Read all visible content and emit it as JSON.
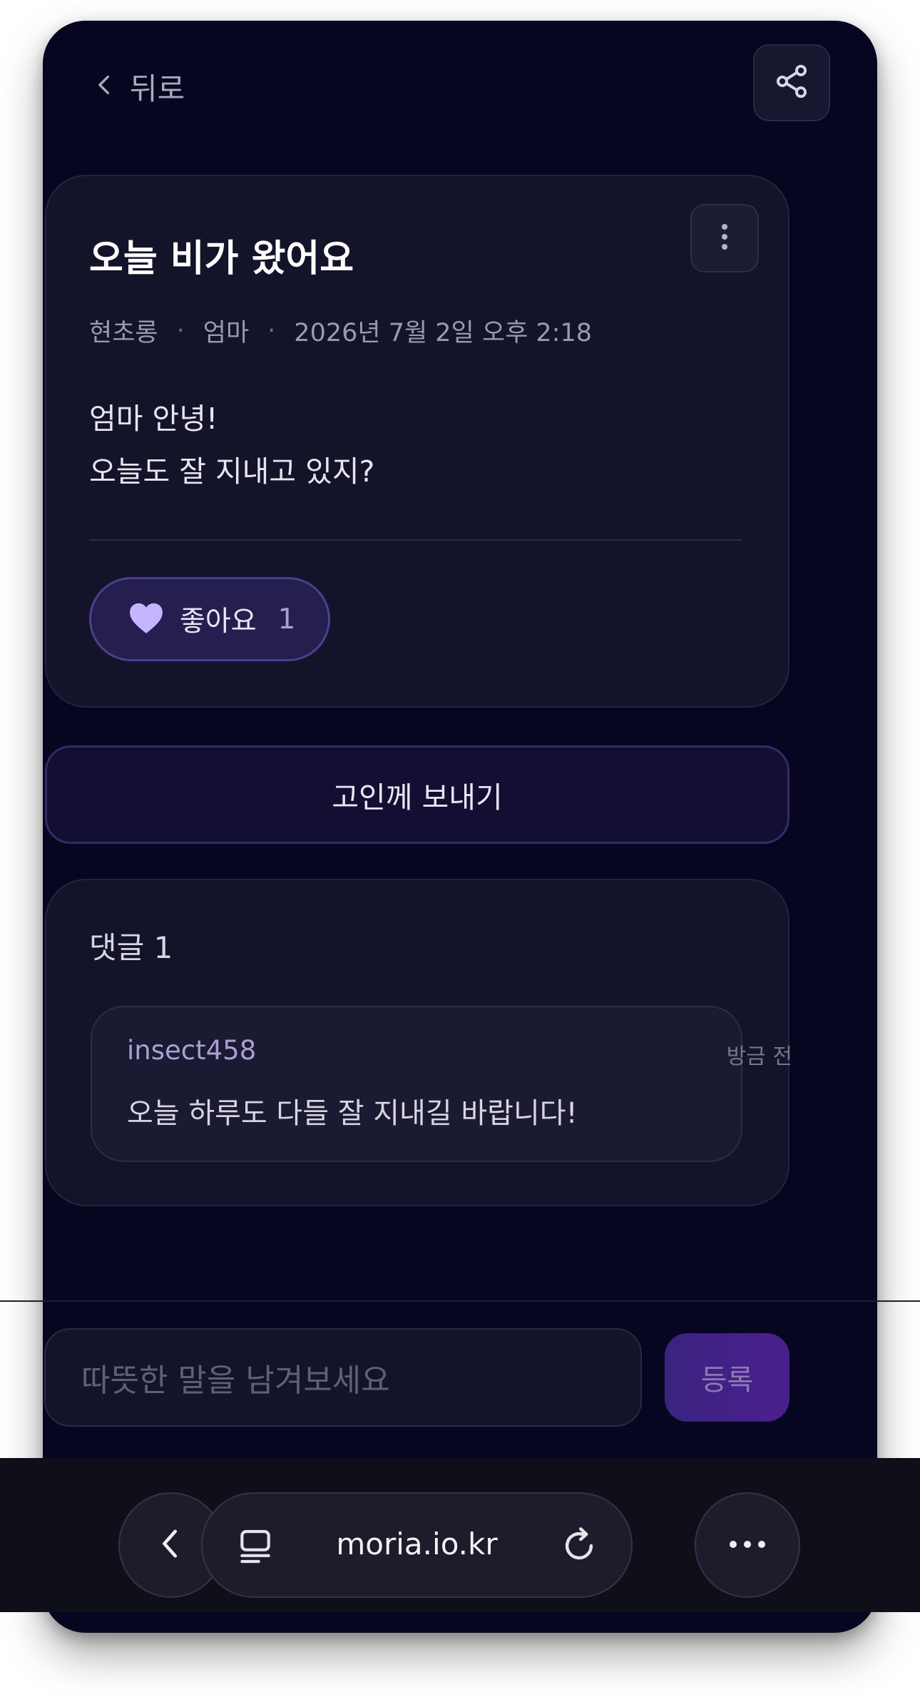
{
  "header": {
    "back_label": "뒤로"
  },
  "post": {
    "title": "오늘 비가 왔어요",
    "author": "현초롱",
    "recipient": "엄마",
    "datetime": "2026년 7월 2일 오후 2:18",
    "body_lines": [
      "엄마 안녕!",
      "오늘도 잘 지내고 있지?"
    ],
    "like_label": "좋아요",
    "like_count": "1"
  },
  "send_button_label": "고인께 보내기",
  "comments": {
    "title": "댓글 1",
    "items": [
      {
        "user": "insect458",
        "time": "방금 전",
        "text": "오늘 하루도 다들 잘 지내길 바랍니다!"
      }
    ]
  },
  "comment_input": {
    "placeholder": "따뜻한 말을 남겨보세요",
    "submit_label": "등록"
  },
  "browser": {
    "url": "moria.io.kr"
  },
  "colors": {
    "background": "#070620",
    "card": "#13132a",
    "accent": "#4b3f8e",
    "heart": "#c4b5fd"
  }
}
